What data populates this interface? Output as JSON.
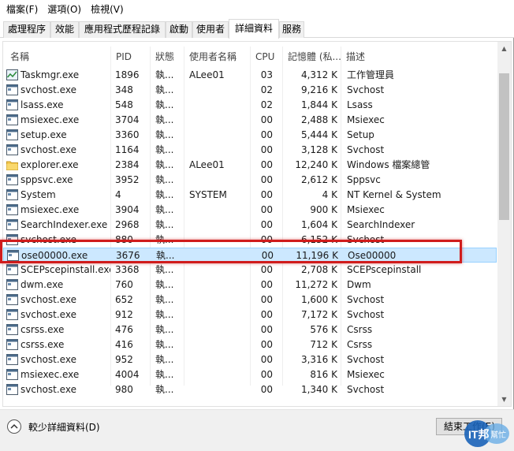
{
  "menu": [
    "檔案(F)",
    "選項(O)",
    "檢視(V)"
  ],
  "tabs": [
    "處理程序",
    "效能",
    "應用程式歷程記錄",
    "啟動",
    "使用者",
    "詳細資料",
    "服務"
  ],
  "active_tab_index": 5,
  "columns": [
    "名稱",
    "PID",
    "狀態",
    "使用者名稱",
    "CPU",
    "記憶體 (私...",
    "描述"
  ],
  "rows": [
    {
      "name": "Taskmgr.exe",
      "pid": "1896",
      "status": "執...",
      "user": "ALee01",
      "cpu": "03",
      "mem": "4,312 K",
      "desc": "工作管理員",
      "icon": "taskmgr-icon"
    },
    {
      "name": "svchost.exe",
      "pid": "348",
      "status": "執...",
      "user": "",
      "cpu": "02",
      "mem": "9,216 K",
      "desc": "Svchost",
      "icon": "app-window-icon"
    },
    {
      "name": "lsass.exe",
      "pid": "548",
      "status": "執...",
      "user": "",
      "cpu": "02",
      "mem": "1,844 K",
      "desc": "Lsass",
      "icon": "app-window-icon"
    },
    {
      "name": "msiexec.exe",
      "pid": "3704",
      "status": "執...",
      "user": "",
      "cpu": "00",
      "mem": "2,488 K",
      "desc": "Msiexec",
      "icon": "app-window-icon"
    },
    {
      "name": "setup.exe",
      "pid": "3360",
      "status": "執...",
      "user": "",
      "cpu": "00",
      "mem": "5,444 K",
      "desc": "Setup",
      "icon": "app-window-icon"
    },
    {
      "name": "svchost.exe",
      "pid": "1164",
      "status": "執...",
      "user": "",
      "cpu": "00",
      "mem": "3,128 K",
      "desc": "Svchost",
      "icon": "app-window-icon"
    },
    {
      "name": "explorer.exe",
      "pid": "2384",
      "status": "執...",
      "user": "ALee01",
      "cpu": "00",
      "mem": "12,240 K",
      "desc": "Windows 檔案總管",
      "icon": "folder-icon"
    },
    {
      "name": "sppsvc.exe",
      "pid": "3952",
      "status": "執...",
      "user": "",
      "cpu": "00",
      "mem": "2,612 K",
      "desc": "Sppsvc",
      "icon": "app-window-icon"
    },
    {
      "name": "System",
      "pid": "4",
      "status": "執...",
      "user": "SYSTEM",
      "cpu": "00",
      "mem": "4 K",
      "desc": "NT Kernel & System",
      "icon": "app-window-icon"
    },
    {
      "name": "msiexec.exe",
      "pid": "3904",
      "status": "執...",
      "user": "",
      "cpu": "00",
      "mem": "900 K",
      "desc": "Msiexec",
      "icon": "app-window-icon"
    },
    {
      "name": "SearchIndexer.exe",
      "pid": "2968",
      "status": "執...",
      "user": "",
      "cpu": "00",
      "mem": "1,604 K",
      "desc": "SearchIndexer",
      "icon": "app-window-icon"
    },
    {
      "name": "svchost.exe",
      "pid": "880",
      "status": "執...",
      "user": "",
      "cpu": "00",
      "mem": "6,152 K",
      "desc": "Svchost",
      "icon": "app-window-icon"
    },
    {
      "name": "ose00000.exe",
      "pid": "3676",
      "status": "執...",
      "user": "",
      "cpu": "00",
      "mem": "11,196 K",
      "desc": "Ose00000",
      "icon": "app-window-icon"
    },
    {
      "name": "SCEPscepinstall.exe",
      "pid": "3368",
      "status": "執...",
      "user": "",
      "cpu": "00",
      "mem": "2,708 K",
      "desc": "SCEPscepinstall",
      "icon": "app-window-icon"
    },
    {
      "name": "dwm.exe",
      "pid": "760",
      "status": "執...",
      "user": "",
      "cpu": "00",
      "mem": "11,272 K",
      "desc": "Dwm",
      "icon": "app-window-icon"
    },
    {
      "name": "svchost.exe",
      "pid": "652",
      "status": "執...",
      "user": "",
      "cpu": "00",
      "mem": "1,600 K",
      "desc": "Svchost",
      "icon": "app-window-icon"
    },
    {
      "name": "svchost.exe",
      "pid": "912",
      "status": "執...",
      "user": "",
      "cpu": "00",
      "mem": "7,172 K",
      "desc": "Svchost",
      "icon": "app-window-icon"
    },
    {
      "name": "csrss.exe",
      "pid": "476",
      "status": "執...",
      "user": "",
      "cpu": "00",
      "mem": "576 K",
      "desc": "Csrss",
      "icon": "app-window-icon"
    },
    {
      "name": "csrss.exe",
      "pid": "416",
      "status": "執...",
      "user": "",
      "cpu": "00",
      "mem": "712 K",
      "desc": "Csrss",
      "icon": "app-window-icon"
    },
    {
      "name": "svchost.exe",
      "pid": "952",
      "status": "執...",
      "user": "",
      "cpu": "00",
      "mem": "3,316 K",
      "desc": "Svchost",
      "icon": "app-window-icon"
    },
    {
      "name": "msiexec.exe",
      "pid": "4004",
      "status": "執...",
      "user": "",
      "cpu": "00",
      "mem": "816 K",
      "desc": "Msiexec",
      "icon": "app-window-icon"
    },
    {
      "name": "svchost.exe",
      "pid": "980",
      "status": "執...",
      "user": "",
      "cpu": "00",
      "mem": "1,340 K",
      "desc": "Svchost",
      "icon": "app-window-icon"
    }
  ],
  "selected_row_index": 12,
  "footer": {
    "fewer_details_label": "較少詳細資料(D)",
    "end_task_label": "結束工作(E)"
  },
  "watermark": {
    "brand": "IT邦",
    "sub": "幫忙"
  },
  "colors": {
    "selection": "#cce8ff",
    "selection_border": "#99d1ff",
    "annotation": "#d01c1c"
  }
}
